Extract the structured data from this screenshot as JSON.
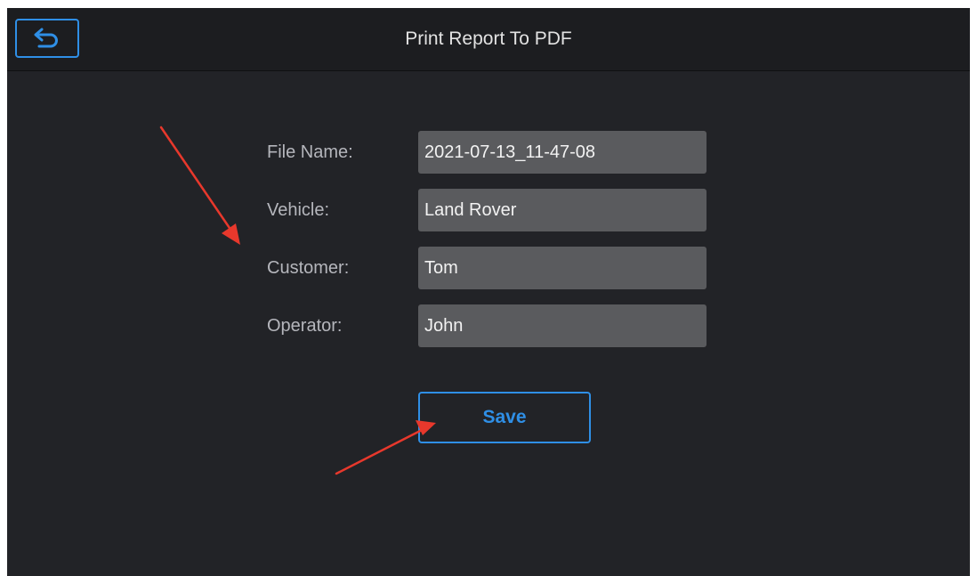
{
  "header": {
    "title": "Print Report To PDF",
    "back_icon": "back-arrow-icon"
  },
  "form": {
    "fields": [
      {
        "label": "File Name:",
        "value": "2021-07-13_11-47-08"
      },
      {
        "label": "Vehicle:",
        "value": "Land Rover"
      },
      {
        "label": "Customer:",
        "value": "Tom"
      },
      {
        "label": "Operator:",
        "value": "John"
      }
    ],
    "save_label": "Save"
  },
  "annotations": {
    "arrow_icon": "red-arrow-icon",
    "arrow_color": "#e8382c"
  },
  "colors": {
    "accent": "#2f8fe6",
    "background": "#222327",
    "header_background": "#1c1d20",
    "field_background": "#5a5b5e"
  }
}
